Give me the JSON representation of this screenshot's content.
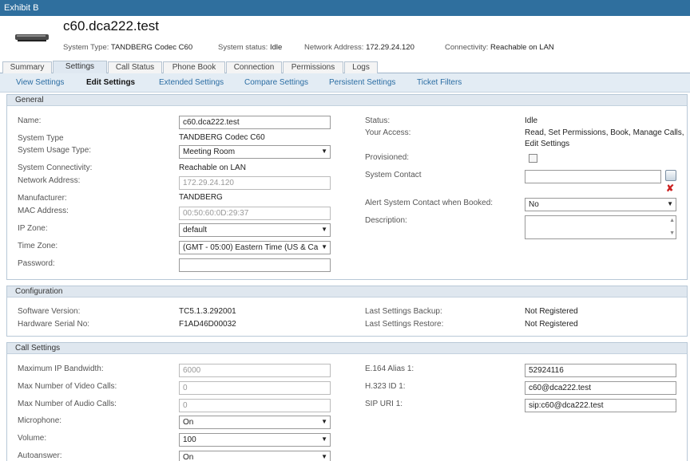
{
  "window": {
    "title": "Exhibit B"
  },
  "system": {
    "name": "c60.dca222.test",
    "type_label": "System Type:",
    "type_value": "TANDBERG Codec C60",
    "status_label": "System status:",
    "status_value": "Idle",
    "address_label": "Network Address:",
    "address_value": "172.29.24.120",
    "connectivity_label": "Connectivity:",
    "connectivity_value": "Reachable on LAN"
  },
  "tabs": [
    "Summary",
    "Settings",
    "Call Status",
    "Phone Book",
    "Connection",
    "Permissions",
    "Logs"
  ],
  "active_tab": "Settings",
  "subnav": [
    "View Settings",
    "Edit Settings",
    "Extended Settings",
    "Compare Settings",
    "Persistent Settings",
    "Ticket Filters"
  ],
  "active_subnav": "Edit Settings",
  "general": {
    "title": "General",
    "name_label": "Name:",
    "name_value": "c60.dca222.test",
    "system_type_label": "System Type",
    "system_type_value": "TANDBERG Codec C60",
    "usage_label": "System Usage Type:",
    "usage_value": "Meeting Room",
    "connectivity_label": "System Connectivity:",
    "connectivity_value": "Reachable on LAN",
    "network_label": "Network Address:",
    "network_value": "172.29.24.120",
    "manufacturer_label": "Manufacturer:",
    "manufacturer_value": "TANDBERG",
    "mac_label": "MAC Address:",
    "mac_value": "00:50:60:0D:29:37",
    "ipzone_label": "IP Zone:",
    "ipzone_value": "default",
    "timezone_label": "Time Zone:",
    "timezone_value": "(GMT - 05:00) Eastern Time (US & Ca",
    "password_label": "Password:",
    "password_value": "",
    "status_label": "Status:",
    "status_value": "Idle",
    "access_label": "Your Access:",
    "access_value_1": "Read, Set Permissions, Book, Manage Calls,",
    "access_value_2": "Edit Settings",
    "provisioned_label": "Provisioned:",
    "contact_label": "System Contact",
    "alert_label": "Alert System Contact when Booked:",
    "alert_value": "No",
    "description_label": "Description:"
  },
  "configuration": {
    "title": "Configuration",
    "sw_label": "Software Version:",
    "sw_value": "TC5.1.3.292001",
    "hw_label": "Hardware Serial No:",
    "hw_value": "F1AD46D00032",
    "backup_label": "Last Settings Backup:",
    "backup_value": "Not Registered",
    "restore_label": "Last Settings Restore:",
    "restore_value": "Not Registered"
  },
  "call_settings": {
    "title": "Call Settings",
    "bw_label": "Maximum IP Bandwidth:",
    "bw_value": "6000",
    "video_label": "Max Number of Video Calls:",
    "video_value": "0",
    "audio_label": "Max Number of Audio Calls:",
    "audio_value": "0",
    "mic_label": "Microphone:",
    "mic_value": "On",
    "volume_label": "Volume:",
    "volume_value": "100",
    "autoanswer_label": "Autoanswer:",
    "autoanswer_value": "On",
    "e164_label": "E.164 Alias 1:",
    "e164_value": "52924116",
    "h323_label": "H.323 ID 1:",
    "h323_value": "c60@dca222.test",
    "sip_label": "SIP URI 1:",
    "sip_value": "sip:c60@dca222.test"
  },
  "colors": {
    "titlebar": "#2f6f9e",
    "link": "#2b6da3",
    "section_head": "#dfe7ef"
  }
}
